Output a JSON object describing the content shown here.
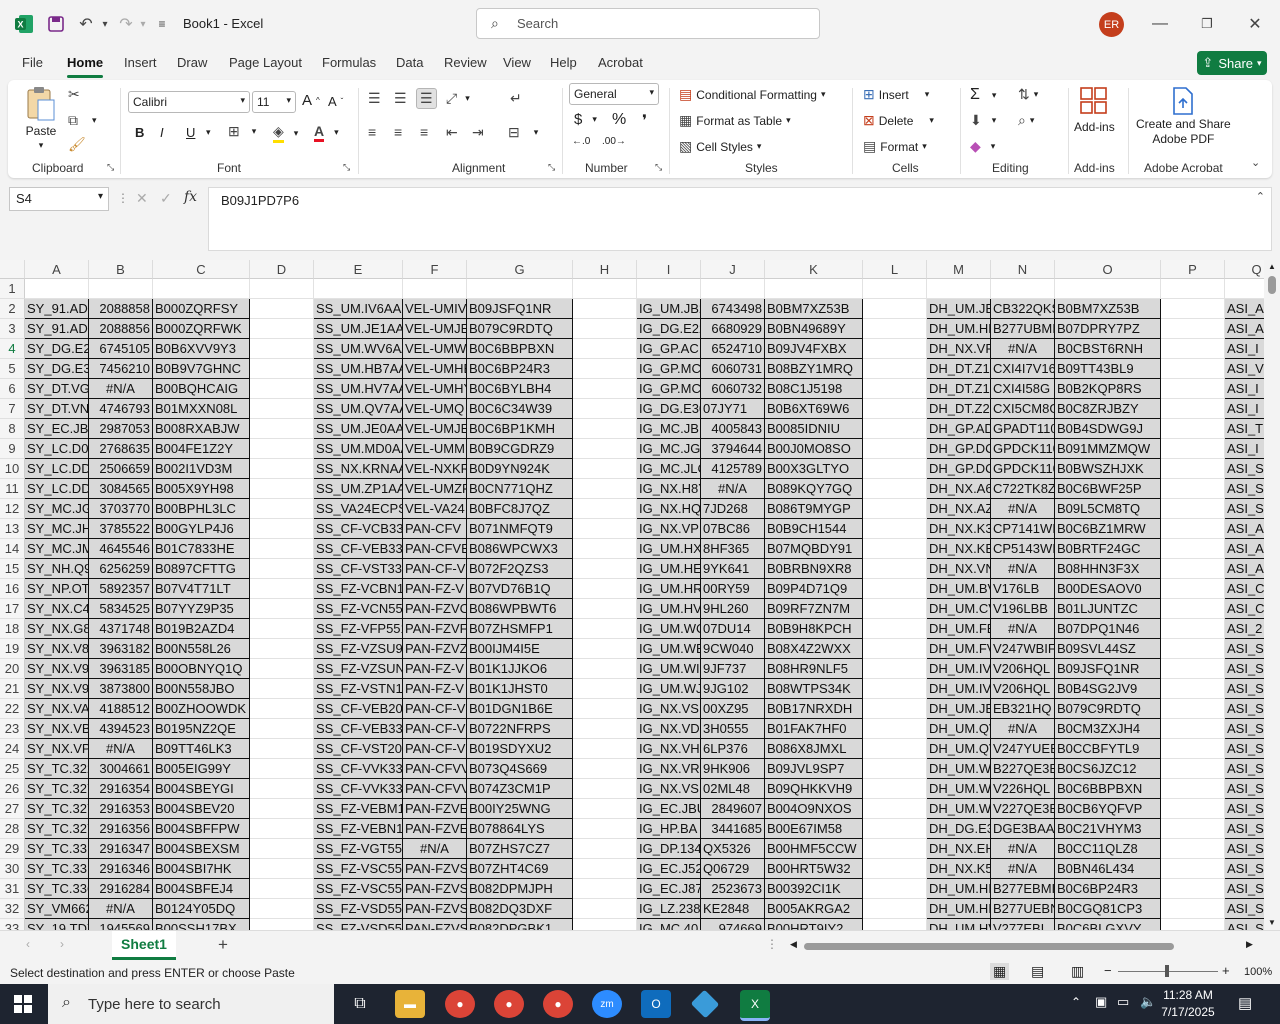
{
  "titlebar": {
    "app_title": "Book1  -  Excel",
    "search_placeholder": "Search",
    "user_initials": "ER"
  },
  "menu": {
    "tabs": [
      "File",
      "Home",
      "Insert",
      "Draw",
      "Page Layout",
      "Formulas",
      "Data",
      "Review",
      "View",
      "Help",
      "Acrobat"
    ],
    "active": "Home",
    "share_label": "Share"
  },
  "ribbon": {
    "clipboard": {
      "paste": "Paste",
      "label": "Clipboard"
    },
    "font": {
      "name": "Calibri",
      "size": "11",
      "label": "Font",
      "bold": "B",
      "italic": "I",
      "underline": "U"
    },
    "alignment": {
      "label": "Alignment"
    },
    "number": {
      "format": "General",
      "label": "Number"
    },
    "styles": {
      "conditional": "Conditional Formatting",
      "format_table": "Format as Table",
      "cell_styles": "Cell Styles",
      "label": "Styles"
    },
    "cells": {
      "insert": "Insert",
      "delete": "Delete",
      "format": "Format",
      "label": "Cells"
    },
    "editing": {
      "label": "Editing"
    },
    "addins": {
      "button": "Add-ins",
      "label": "Add-ins"
    },
    "acrobat": {
      "button_line1": "Create and Share",
      "button_line2": "Adobe PDF",
      "label": "Adobe Acrobat"
    }
  },
  "formula_bar": {
    "name_box": "S4",
    "fx": "fx",
    "formula": "B09J1PD7P6"
  },
  "grid": {
    "columns": [
      "A",
      "B",
      "C",
      "D",
      "E",
      "F",
      "G",
      "H",
      "I",
      "J",
      "K",
      "L",
      "M",
      "N",
      "O",
      "P",
      "Q"
    ],
    "rows": [
      {
        "n": "1",
        "c": [
          "",
          "",
          "",
          "",
          "",
          "",
          "",
          "",
          "",
          "",
          "",
          "",
          "",
          "",
          "",
          "",
          ""
        ]
      },
      {
        "n": "2",
        "c": [
          "SY_91.ADC",
          "2088858",
          "B000ZQRFSY",
          "",
          "SS_UM.IV6AA",
          "VEL-UMIV",
          "B09JSFQ1NR",
          "",
          "IG_UM.JB2",
          "6743498",
          "B0BM7XZ53B",
          "",
          "DH_UM.JB",
          "CB322QKS",
          "B0BM7XZ53B",
          "",
          "ASI_A"
        ]
      },
      {
        "n": "3",
        "c": [
          "SY_91.ADC",
          "2088856",
          "B000ZQRFWK",
          "",
          "SS_UM.JE1AA",
          "VEL-UMJE",
          "B079C9RDTQ",
          "",
          "IG_DG.E22",
          "6680929",
          "B0BN49689Y",
          "",
          "DH_UM.HE",
          "B277UBMI",
          "B07DPRY7PZ",
          "",
          "ASI_A"
        ]
      },
      {
        "n": "4",
        "c": [
          "SY_DG.E2Y",
          "6745105",
          "B0B6XVV9Y3",
          "",
          "SS_UM.WV6AA",
          "VEL-UMW",
          "B0C6BBPBXN",
          "",
          "IG_GP.AC",
          "6524710",
          "B09JV4FXBX",
          "",
          "DH_NX.VF",
          "#N/A",
          "B0CBST6RNH",
          "",
          "ASI_I"
        ]
      },
      {
        "n": "5",
        "c": [
          "SY_DG.E36",
          "7456210",
          "B0B9V7GHNC",
          "",
          "SS_UM.HB7AA",
          "VEL-UMHE",
          "B0C6BP24R3",
          "",
          "IG_GP.MC",
          "6060731",
          "B08BZY1MRQ",
          "",
          "DH_DT.Z1",
          "CXI4I7V16",
          "B09TT43BL9",
          "",
          "ASI_V"
        ]
      },
      {
        "n": "6",
        "c": [
          "SY_DT.VG",
          "#N/A",
          "B00BQHCAIG",
          "",
          "SS_UM.HV7AA",
          "VEL-UMHY",
          "B0C6BYLBH4",
          "",
          "IG_GP.MC",
          "6060732",
          "B08C1J5198",
          "",
          "DH_DT.Z1",
          "CXI4I58G",
          "B0B2KQP8RS",
          "",
          "ASI_I"
        ]
      },
      {
        "n": "7",
        "c": [
          "SY_DT.VN",
          "4746793",
          "B01MXXN08L",
          "",
          "SS_UM.QV7AA",
          "VEL-UMQ",
          "B0C6C34W39",
          "",
          "IG_DG.E30",
          "07JY71",
          "B0B6XT69W6",
          "",
          "DH_DT.Z2",
          "CXI5CM8G",
          "B0C8ZRJBZY",
          "",
          "ASI_I"
        ]
      },
      {
        "n": "8",
        "c": [
          "SY_EC.JBG",
          "2987053",
          "B008RXABJW",
          "",
          "SS_UM.JE0AA",
          "VEL-UMJE",
          "B0C6BP1KMH",
          "",
          "IG_MC.JB",
          "4005843",
          "B0085IDNIU",
          "",
          "DH_GP.AD",
          "GPADT110",
          "B0B4SDWG9J",
          "",
          "ASI_T"
        ]
      },
      {
        "n": "9",
        "c": [
          "SY_LC.D01",
          "2768635",
          "B004FE1Z2Y",
          "",
          "SS_UM.MD0AA",
          "VEL-UMM",
          "B0B9CGDRZ9",
          "",
          "IG_MC.JG",
          "3794644",
          "B00J0MO8SO",
          "",
          "DH_GP.DC",
          "GPDCK110",
          "B091MMZMQW",
          "",
          "ASI_I"
        ]
      },
      {
        "n": "10",
        "c": [
          "SY_LC.DDI",
          "2506659",
          "B002I1VD3M",
          "",
          "SS_NX.KRNAA",
          "VEL-NXKR",
          "B0D9YN924K",
          "",
          "IG_MC.JLC",
          "4125789",
          "B00X3GLTYO",
          "",
          "DH_GP.DC",
          "GPDCK110",
          "B0BWSZHJXK",
          "",
          "ASI_S"
        ]
      },
      {
        "n": "11",
        "c": [
          "SY_LC.DDI",
          "3084565",
          "B005X9YH98",
          "",
          "SS_UM.ZP1AA",
          "VEL-UMZP",
          "B0CN771QHZ",
          "",
          "IG_NX.H8Y",
          "#N/A",
          "B089KQY7GQ",
          "",
          "DH_NX.A6",
          "C722TK8Z",
          "B0C6BWF25P",
          "",
          "ASI_S"
        ]
      },
      {
        "n": "12",
        "c": [
          "SY_MC.JG",
          "3703770",
          "B00BPHL3LC",
          "",
          "SS_VA24ECPS",
          "VEL-VA24",
          "B0BFC8J7QZ",
          "",
          "IG_NX.HQ",
          "7JD268",
          "B086T9MYGP",
          "",
          "DH_NX.AZ",
          "#N/A",
          "B09L5CM8TQ",
          "",
          "ASI_S"
        ]
      },
      {
        "n": "13",
        "c": [
          "SY_MC.JH",
          "3785522",
          "B00GYLP4J6",
          "",
          "SS_CF-VCB331",
          "PAN-CFV",
          "B071NMFQT9",
          "",
          "IG_NX.VP",
          "07BC86",
          "B0B9CH1544",
          "",
          "DH_NX.K3",
          "CP7141WI",
          "B0C6BZ1MRW",
          "",
          "ASI_A"
        ]
      },
      {
        "n": "14",
        "c": [
          "SY_MC.JM",
          "4645546",
          "B01C7833HE",
          "",
          "SS_CF-VEB332",
          "PAN-CFVE",
          "B086WPCWX3",
          "",
          "IG_UM.HX",
          "8HF365",
          "B07MQBDY91",
          "",
          "DH_NX.KE",
          "CP5143WI",
          "B0BRTF24GC",
          "",
          "ASI_A"
        ]
      },
      {
        "n": "15",
        "c": [
          "SY_NH.Q9",
          "6256259",
          "B0897CFTTG",
          "",
          "SS_CF-VST332",
          "PAN-CF-V",
          "B072F2QZS3",
          "",
          "IG_UM.HE",
          "9YK641",
          "B0BRBN9XR8",
          "",
          "DH_NX.VN",
          "#N/A",
          "B08HHN3F3X",
          "",
          "ASI_A"
        ]
      },
      {
        "n": "16",
        "c": [
          "SY_NP.OT",
          "5892357",
          "B07V4T71LT",
          "",
          "SS_FZ-VCBN1",
          "PAN-FZ-V",
          "B07VD76B1Q",
          "",
          "IG_UM.HR",
          "00RY59",
          "B09P4D71Q9",
          "",
          "DH_UM.BV",
          "V176LB",
          "B00DESAOV0",
          "",
          "ASI_C"
        ]
      },
      {
        "n": "17",
        "c": [
          "SY_NX.C4",
          "5834525",
          "B07YYZ9P35",
          "",
          "SS_FZ-VCN551",
          "PAN-FZVC",
          "B086WPBWT6",
          "",
          "IG_UM.HV",
          "9HL260",
          "B09RF7ZN7M",
          "",
          "DH_UM.CV",
          "V196LBB",
          "B01LJUNTZC",
          "",
          "ASI_C"
        ]
      },
      {
        "n": "18",
        "c": [
          "SY_NX.G8",
          "4371748",
          "B019B2AZD4",
          "",
          "SS_FZ-VFP551",
          "PAN-FZVF",
          "B07ZHSMFP1",
          "",
          "IG_UM.WC",
          "07DU14",
          "B0B9H8KPCH",
          "",
          "DH_UM.FE",
          "#N/A",
          "B07DPQ1N46",
          "",
          "ASI_2"
        ]
      },
      {
        "n": "19",
        "c": [
          "SY_NX.V8",
          "3963182",
          "B00N558L26",
          "",
          "SS_FZ-VZSU94",
          "PAN-FZVZ",
          "B00IJM4I5E",
          "",
          "IG_UM.WE",
          "9CW040",
          "B08X4Z2WXX",
          "",
          "DH_UM.FV",
          "V247WBIF",
          "B09SVL44SZ",
          "",
          "ASI_S"
        ]
      },
      {
        "n": "20",
        "c": [
          "SY_NX.V9",
          "3963185",
          "B00OBNYQ1Q",
          "",
          "SS_FZ-VZSUN",
          "PAN-FZ-V",
          "B01K1JJKO6",
          "",
          "IG_UM.WI",
          "9JF737",
          "B08HR9NLF5",
          "",
          "DH_UM.IV",
          "V206HQL",
          "B09JSFQ1NR",
          "",
          "ASI_S"
        ]
      },
      {
        "n": "21",
        "c": [
          "SY_NX.V9",
          "3873800",
          "B00N558JBO",
          "",
          "SS_FZ-VSTN12",
          "PAN-FZ-V",
          "B01K1JHST0",
          "",
          "IG_UM.WJ",
          "9JG102",
          "B08WTPS34K",
          "",
          "DH_UM.IV",
          "V206HQL",
          "B0B4SG2JV9",
          "",
          "ASI_S"
        ]
      },
      {
        "n": "22",
        "c": [
          "SY_NX.VA",
          "4188512",
          "B00ZHOOWDK",
          "",
          "SS_CF-VEB201",
          "PAN-CF-V",
          "B01DGN1B6E",
          "",
          "IG_NX.VS",
          "00XZ95",
          "B0B17NRXDH",
          "",
          "DH_UM.JB",
          "EB321HQ",
          "B079C9RDTQ",
          "",
          "ASI_S"
        ]
      },
      {
        "n": "23",
        "c": [
          "SY_NX.VB",
          "4394523",
          "B0195NZ2QE",
          "",
          "SS_CF-VEB331",
          "PAN-CF-V",
          "B0722NFRPS",
          "",
          "IG_NX.VD",
          "3H0555",
          "B01FAK7HF0",
          "",
          "DH_UM.QV",
          "#N/A",
          "B0CM3ZXJH4",
          "",
          "ASI_S"
        ]
      },
      {
        "n": "24",
        "c": [
          "SY_NX.VP",
          "#N/A",
          "B09TT46LK3",
          "",
          "SS_CF-VST201",
          "PAN-CF-V",
          "B019SDYXU2",
          "",
          "IG_NX.VH",
          "6LP376",
          "B086X8JMXL",
          "",
          "DH_UM.QV",
          "V247YUEB",
          "B0CCBFYTL9",
          "",
          "ASI_S"
        ]
      },
      {
        "n": "25",
        "c": [
          "SY_TC.322",
          "3004661",
          "B005EIG99Y",
          "",
          "SS_CF-VVK331",
          "PAN-CFVV",
          "B073Q4S669",
          "",
          "IG_NX.VR",
          "9HK906",
          "B09JVL9SP7",
          "",
          "DH_UM.W",
          "B227QE3B",
          "B0CS6JZC12",
          "",
          "ASI_S"
        ]
      },
      {
        "n": "26",
        "c": [
          "SY_TC.327",
          "2916354",
          "B004SBEYGI",
          "",
          "SS_CF-VVK332",
          "PAN-CFVV",
          "B074Z3CM1P",
          "",
          "IG_NX.VS",
          "02ML48",
          "B09QHKKVH9",
          "",
          "DH_UM.W",
          "V226HQL",
          "B0C6BBPBXN",
          "",
          "ASI_S"
        ]
      },
      {
        "n": "27",
        "c": [
          "SY_TC.327",
          "2916353",
          "B004SBEV20",
          "",
          "SS_FZ-VEBM1",
          "PAN-FZVE",
          "B00IY25WNG",
          "",
          "IG_EC.JBU",
          "2849607",
          "B004O9NXOS",
          "",
          "DH_UM.W",
          "V227QE3B",
          "B0CB6YQFVP",
          "",
          "ASI_S"
        ]
      },
      {
        "n": "28",
        "c": [
          "SY_TC.327",
          "2916356",
          "B004SBFFPW",
          "",
          "SS_FZ-VEBN1",
          "PAN-FZVE",
          "B078864LYS",
          "",
          "IG_HP.BA",
          "3441685",
          "B00E67IM58",
          "",
          "DH_DG.E3",
          "DGE3BAA",
          "B0C21VHYM3",
          "",
          "ASI_S"
        ]
      },
      {
        "n": "29",
        "c": [
          "SY_TC.331",
          "2916347",
          "B004SBEXSM",
          "",
          "SS_FZ-VGT551",
          "#N/A",
          "B07ZHS7CZ7",
          "",
          "IG_DP.134",
          "QX5326",
          "B00HMF5CCW",
          "",
          "DH_NX.EH",
          "#N/A",
          "B0CC11QLZ8",
          "",
          "ASI_S"
        ]
      },
      {
        "n": "30",
        "c": [
          "SY_TC.331",
          "2916346",
          "B004SBI7HK",
          "",
          "SS_FZ-VSC551",
          "PAN-FZVS",
          "B07ZHT4C69",
          "",
          "IG_EC.J52",
          "Q06729",
          "B00HRT5W32",
          "",
          "DH_NX.K5",
          "#N/A",
          "B0BN46L434",
          "",
          "ASI_S"
        ]
      },
      {
        "n": "31",
        "c": [
          "SY_TC.336",
          "2916284",
          "B004SBFEJ4",
          "",
          "SS_FZ-VSC552",
          "PAN-FZVS",
          "B082DPMJPH",
          "",
          "IG_EC.J87",
          "2523673",
          "B00392CI1K",
          "",
          "DH_UM.HI",
          "B277EBMI",
          "B0C6BP24R3",
          "",
          "ASI_S"
        ]
      },
      {
        "n": "32",
        "c": [
          "SY_VM662",
          "#N/A",
          "B0124Y05DQ",
          "",
          "SS_FZ-VSD551",
          "PAN-FZVS",
          "B082DQ3DXF",
          "",
          "IG_LZ.238",
          "KE2848",
          "B005AKRGA2",
          "",
          "DH_UM.HI",
          "B277UEBN",
          "B0CGQ81CP3",
          "",
          "ASI_S"
        ]
      },
      {
        "n": "33",
        "c": [
          "SY_19.TDY",
          "1945569",
          "B00SSH17BX",
          "",
          "SS_FZ-VSD552",
          "PAN-FZVS",
          "B082DPGBK1",
          "",
          "IG_MC.40",
          "974669",
          "B00HRT9IY2",
          "",
          "DH_UM.HV",
          "V277EBL",
          "B0C6BLGXVY",
          "",
          "ASI_S"
        ]
      }
    ]
  },
  "sheet_tabs": {
    "active": "Sheet1",
    "add": "+"
  },
  "status": {
    "message": "Select destination and press ENTER or choose Paste",
    "zoom": "100%"
  },
  "taskbar": {
    "search_placeholder": "Type here to search",
    "time": "11:28 AM",
    "date": "7/17/2025"
  },
  "colors": {
    "excel_green": "#107c41",
    "selected_fill": "#d9d9d9",
    "avatar": "#c43e1c"
  }
}
